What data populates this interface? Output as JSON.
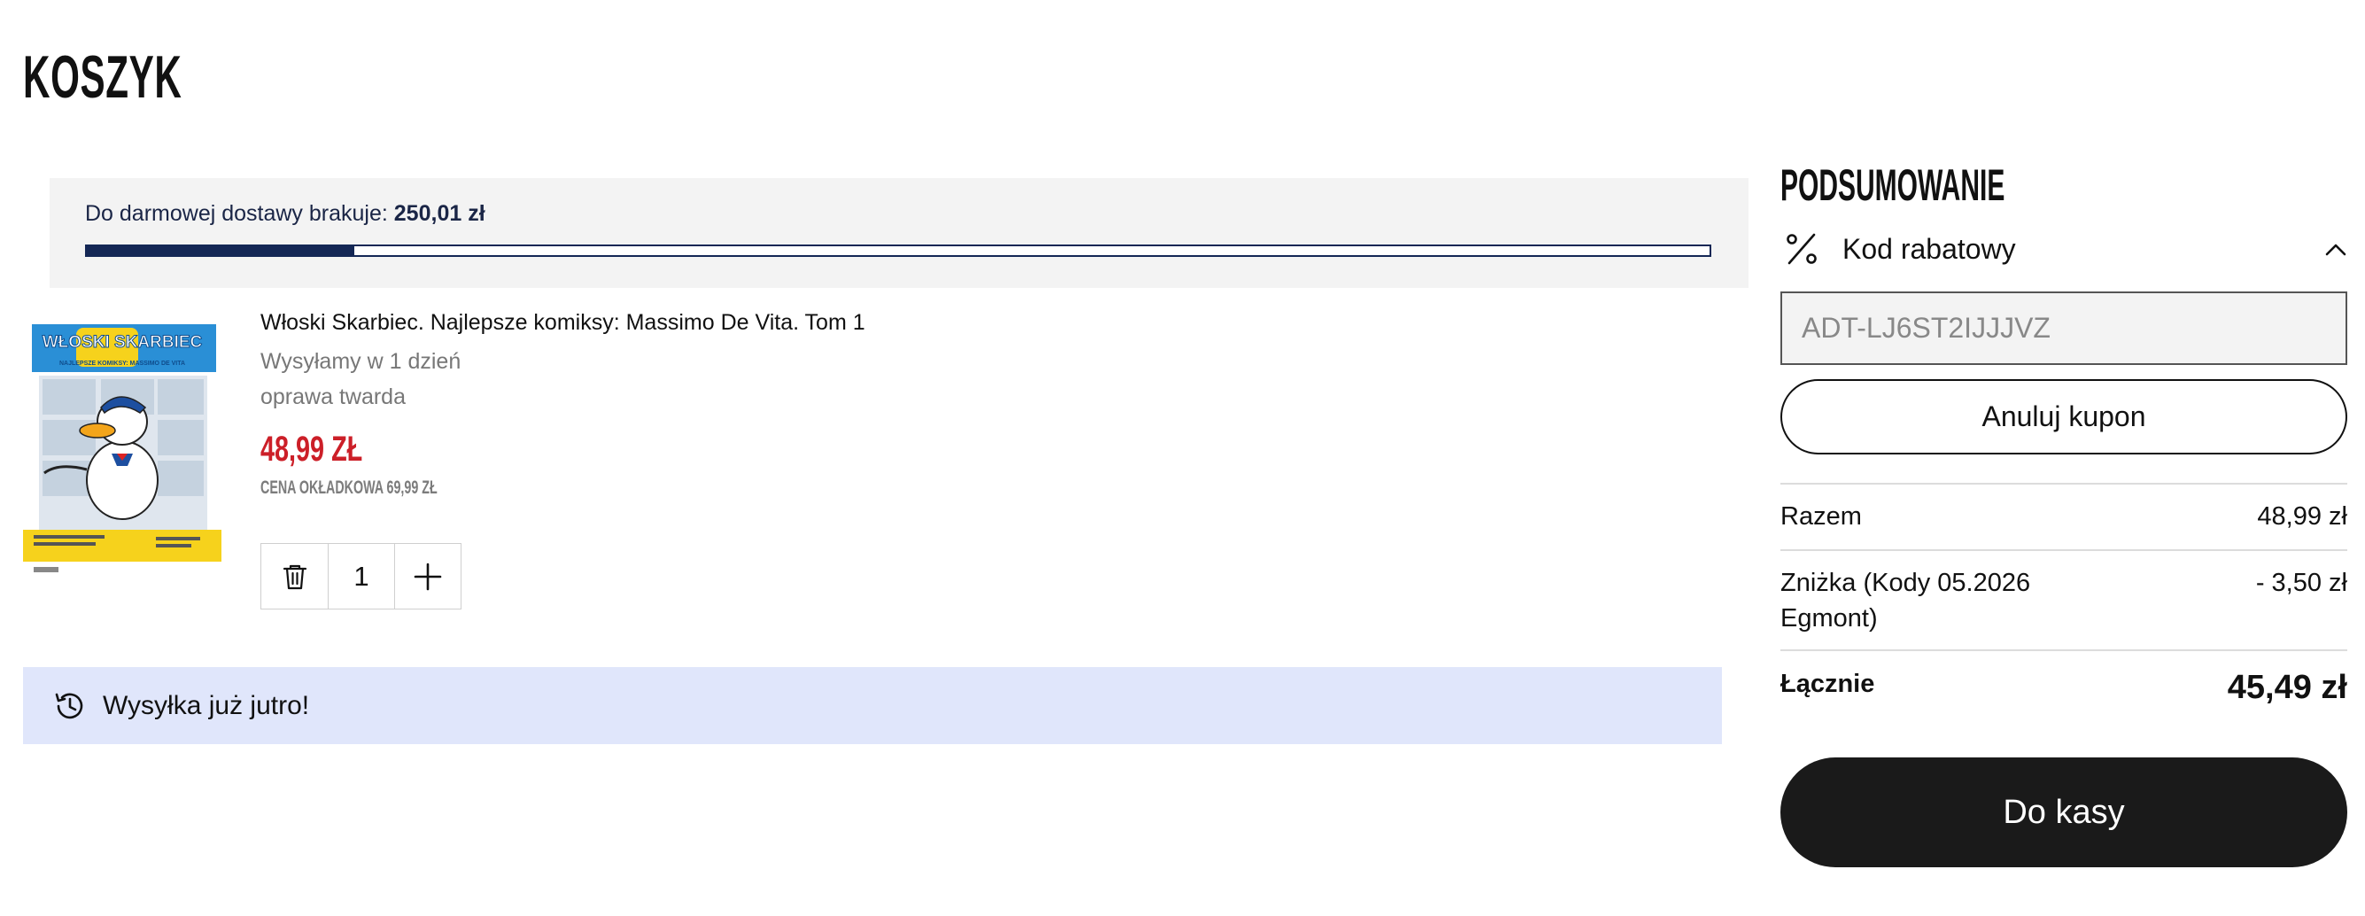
{
  "page": {
    "title": "KOSZYK"
  },
  "shipping": {
    "text": "Do darmowej dostawy brakuje: ",
    "amount": "250,01 zł",
    "progress_fraction": 0.165
  },
  "product": {
    "cover_title": "WŁOSKI SKARBIEC",
    "cover_subtitle": "NAJLEPSZE KOMIKSY: MASSIMO DE VITA",
    "title": "Włoski Skarbiec. Najlepsze komiksy: Massimo De Vita. Tom 1",
    "shipping_time": "Wysyłamy w 1 dzień",
    "binding": "oprawa twarda",
    "price": "48,99 ZŁ",
    "cover_price": "CENA OKŁADKOWA 69,99 ZŁ",
    "quantity": "1"
  },
  "delivery": {
    "text": "Wysyłka już jutro!"
  },
  "summary": {
    "title": "PODSUMOWANIE",
    "coupon_label": "Kod rabatowy",
    "coupon_code": "ADT-LJ6ST2IJJJVZ",
    "cancel_coupon": "Anuluj kupon",
    "subtotal_label": "Razem",
    "subtotal_value": "48,99 zł",
    "discount_label": "Zniżka (Kody 05.2026 Egmont)",
    "discount_value": "- 3,50 zł",
    "total_label": "Łącznie",
    "total_value": "45,49 zł",
    "checkout": "Do kasy"
  },
  "colors": {
    "accent_navy": "#142755",
    "price_red": "#cc1f28",
    "banner_blue": "#e0e6fb",
    "checkout_black": "#1a1a1a"
  },
  "icons": {
    "delete": "trash-icon",
    "increase": "plus-icon",
    "delivery": "clock-history-icon",
    "coupon": "percent-icon",
    "collapse": "chevron-up-icon"
  }
}
